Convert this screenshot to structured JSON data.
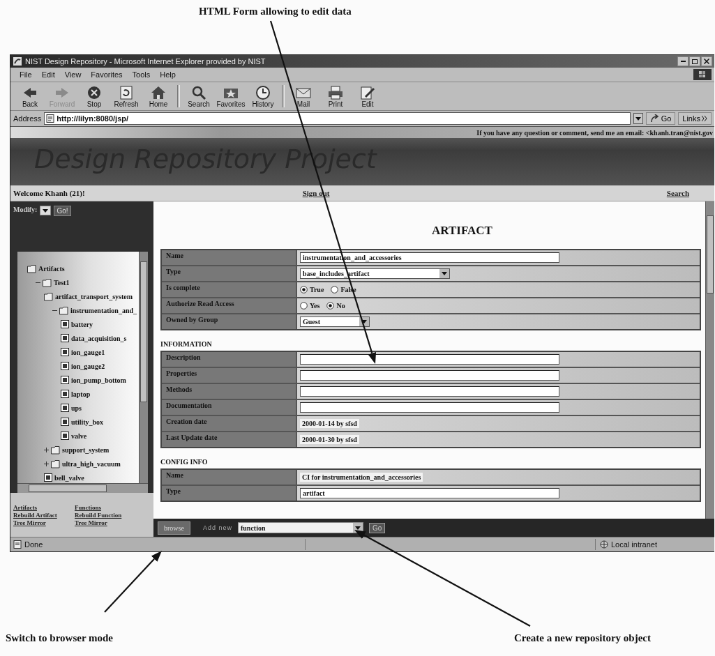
{
  "annotations": {
    "top": "HTML Form allowing to edit data",
    "bottom": [
      "Switch to browser mode",
      "Create a new repository object"
    ]
  },
  "window": {
    "title": "NIST Design Repository - Microsoft Internet Explorer provided by NIST"
  },
  "menu": [
    "File",
    "Edit",
    "View",
    "Favorites",
    "Tools",
    "Help"
  ],
  "toolbar": [
    {
      "kind": "back",
      "label": "Back",
      "disabled": false
    },
    {
      "kind": "forward",
      "label": "Forward",
      "disabled": true
    },
    {
      "kind": "stop",
      "label": "Stop",
      "disabled": false
    },
    {
      "kind": "refresh",
      "label": "Refresh",
      "disabled": false
    },
    {
      "kind": "home",
      "label": "Home",
      "disabled": false
    },
    {
      "kind": "search",
      "label": "Search",
      "disabled": false
    },
    {
      "kind": "favorites",
      "label": "Favorites",
      "disabled": false
    },
    {
      "kind": "history",
      "label": "History",
      "disabled": false
    },
    {
      "kind": "mail",
      "label": "Mail",
      "disabled": false
    },
    {
      "kind": "print",
      "label": "Print",
      "disabled": false
    },
    {
      "kind": "edit",
      "label": "Edit",
      "disabled": false
    }
  ],
  "address": {
    "label": "Address",
    "url": "http://lilyn:8080/jsp/",
    "go": "Go",
    "links": "Links"
  },
  "banner": {
    "notice": "If you have any question or comment, send me an email: <khanh.tran@nist.gov",
    "title": "Design Repository Project"
  },
  "welcome_bar": {
    "welcome": "Welcome Khanh (21)!",
    "sign_out": "Sign out",
    "search": "Search"
  },
  "sidebar": {
    "mode_label": "Modify:",
    "mode_button": "Go!",
    "tree": [
      {
        "label": "Artifacts",
        "kind": "folder",
        "children": [
          {
            "label": "Test1",
            "kind": "folder",
            "expanded": true,
            "children": [
              {
                "label": "artifact_transport_system",
                "kind": "folder",
                "children": [
                  {
                    "label": "instrumentation_and_",
                    "kind": "folder",
                    "expanded": true,
                    "children": [
                      {
                        "label": "battery",
                        "kind": "item"
                      },
                      {
                        "label": "data_acquisition_s",
                        "kind": "item"
                      },
                      {
                        "label": "ion_gauge1",
                        "kind": "item"
                      },
                      {
                        "label": "ion_gauge2",
                        "kind": "item"
                      },
                      {
                        "label": "ion_pump_bottom",
                        "kind": "item"
                      },
                      {
                        "label": "laptop",
                        "kind": "item"
                      },
                      {
                        "label": "ups",
                        "kind": "item"
                      },
                      {
                        "label": "utility_box",
                        "kind": "item"
                      },
                      {
                        "label": "valve",
                        "kind": "item"
                      }
                    ]
                  }
                ]
              },
              {
                "label": "support_system",
                "kind": "folder",
                "expanded": false
              },
              {
                "label": "ultra_high_vacuum",
                "kind": "folder",
                "expanded": false
              },
              {
                "label": "bell_valve",
                "kind": "item"
              }
            ]
          }
        ]
      }
    ],
    "links": [
      {
        "left": "Artifacts",
        "right": "Functions"
      },
      {
        "left": "Rebuild Artifact",
        "right": "Rebuild Function"
      },
      {
        "left": "Tree Mirror",
        "right": "Tree Mirror"
      }
    ]
  },
  "form": {
    "title": "ARTIFACT",
    "sections": [
      {
        "rows": [
          {
            "label": "Name",
            "kind": "text",
            "value": "instrumentation_and_accessories"
          },
          {
            "label": "Type",
            "kind": "select",
            "value": "base_includes_artifact"
          },
          {
            "label": "Is complete",
            "kind": "radio",
            "options": [
              {
                "label": "True",
                "selected": true
              },
              {
                "label": "False",
                "selected": false
              }
            ]
          },
          {
            "label": "Authorize Read Access",
            "kind": "radio",
            "options": [
              {
                "label": "Yes",
                "selected": false
              },
              {
                "label": "No",
                "selected": true
              }
            ]
          },
          {
            "label": "Owned by Group",
            "kind": "select",
            "value": "Guest"
          }
        ]
      },
      {
        "heading": "INFORMATION",
        "rows": [
          {
            "label": "Description",
            "kind": "text"
          },
          {
            "label": "Properties",
            "kind": "text"
          },
          {
            "label": "Methods",
            "kind": "text"
          },
          {
            "label": "Documentation",
            "kind": "text"
          },
          {
            "label": "Creation date",
            "kind": "readonly",
            "value": "2000-01-14 by sfsd"
          },
          {
            "label": "Last Update date",
            "kind": "readonly",
            "value": "2000-01-30 by sfsd"
          }
        ]
      },
      {
        "heading": "CONFIG INFO",
        "rows": [
          {
            "label": "Name",
            "kind": "readonly",
            "value": "CI for instrumentation_and_accessories"
          },
          {
            "label": "Type",
            "kind": "text",
            "value": "artifact"
          }
        ]
      }
    ]
  },
  "bottom_bar": {
    "browse": "browse",
    "add_label": "Add new",
    "add_value": "function",
    "go": "Go"
  },
  "status_bar": {
    "text": "Done",
    "zone": "Local intranet"
  }
}
